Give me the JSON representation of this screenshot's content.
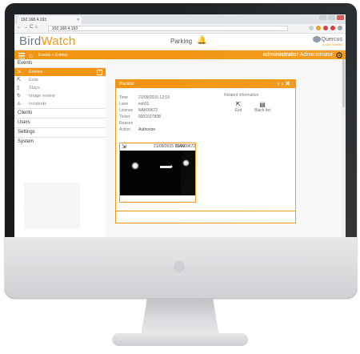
{
  "browser": {
    "tab_title": "192.168.4.193",
    "url": "192.168.4.193"
  },
  "app": {
    "logo_main": "Bird",
    "logo_accent": "Watch",
    "page_title": "Parking",
    "brand_name": "Quercus",
    "brand_tagline": "smart mobility"
  },
  "toolbar": {
    "breadcrumb": "Events > Entries",
    "user_login": "administrator",
    "user_role": "Administrator"
  },
  "sidebar": {
    "events_header": "Events",
    "items": [
      {
        "label": "Entries",
        "active": true
      },
      {
        "label": "Exits"
      },
      {
        "label": "Stays"
      },
      {
        "label": "Image review"
      },
      {
        "label": "Incidents"
      }
    ],
    "sections": [
      "Clients",
      "Users",
      "Settings",
      "System"
    ]
  },
  "dialog": {
    "title": "Blacklist",
    "fields": [
      {
        "key": "Time",
        "value": "21/09/2015 12:19"
      },
      {
        "key": "Lane",
        "value": "exit31"
      },
      {
        "key": "License",
        "value": "NAK09672"
      },
      {
        "key": "Ticket",
        "value": "0001027808"
      },
      {
        "key": "Reason",
        "value": ""
      },
      {
        "key": "Action",
        "value": "Authorize"
      }
    ],
    "related_title": "Related information",
    "related": [
      {
        "label": "Exit",
        "icon": "exit-icon"
      },
      {
        "label": "Black list",
        "icon": "black-list-icon"
      }
    ],
    "capture": {
      "time": "21/09/2015 12:19",
      "plate": "NAK09672"
    }
  }
}
